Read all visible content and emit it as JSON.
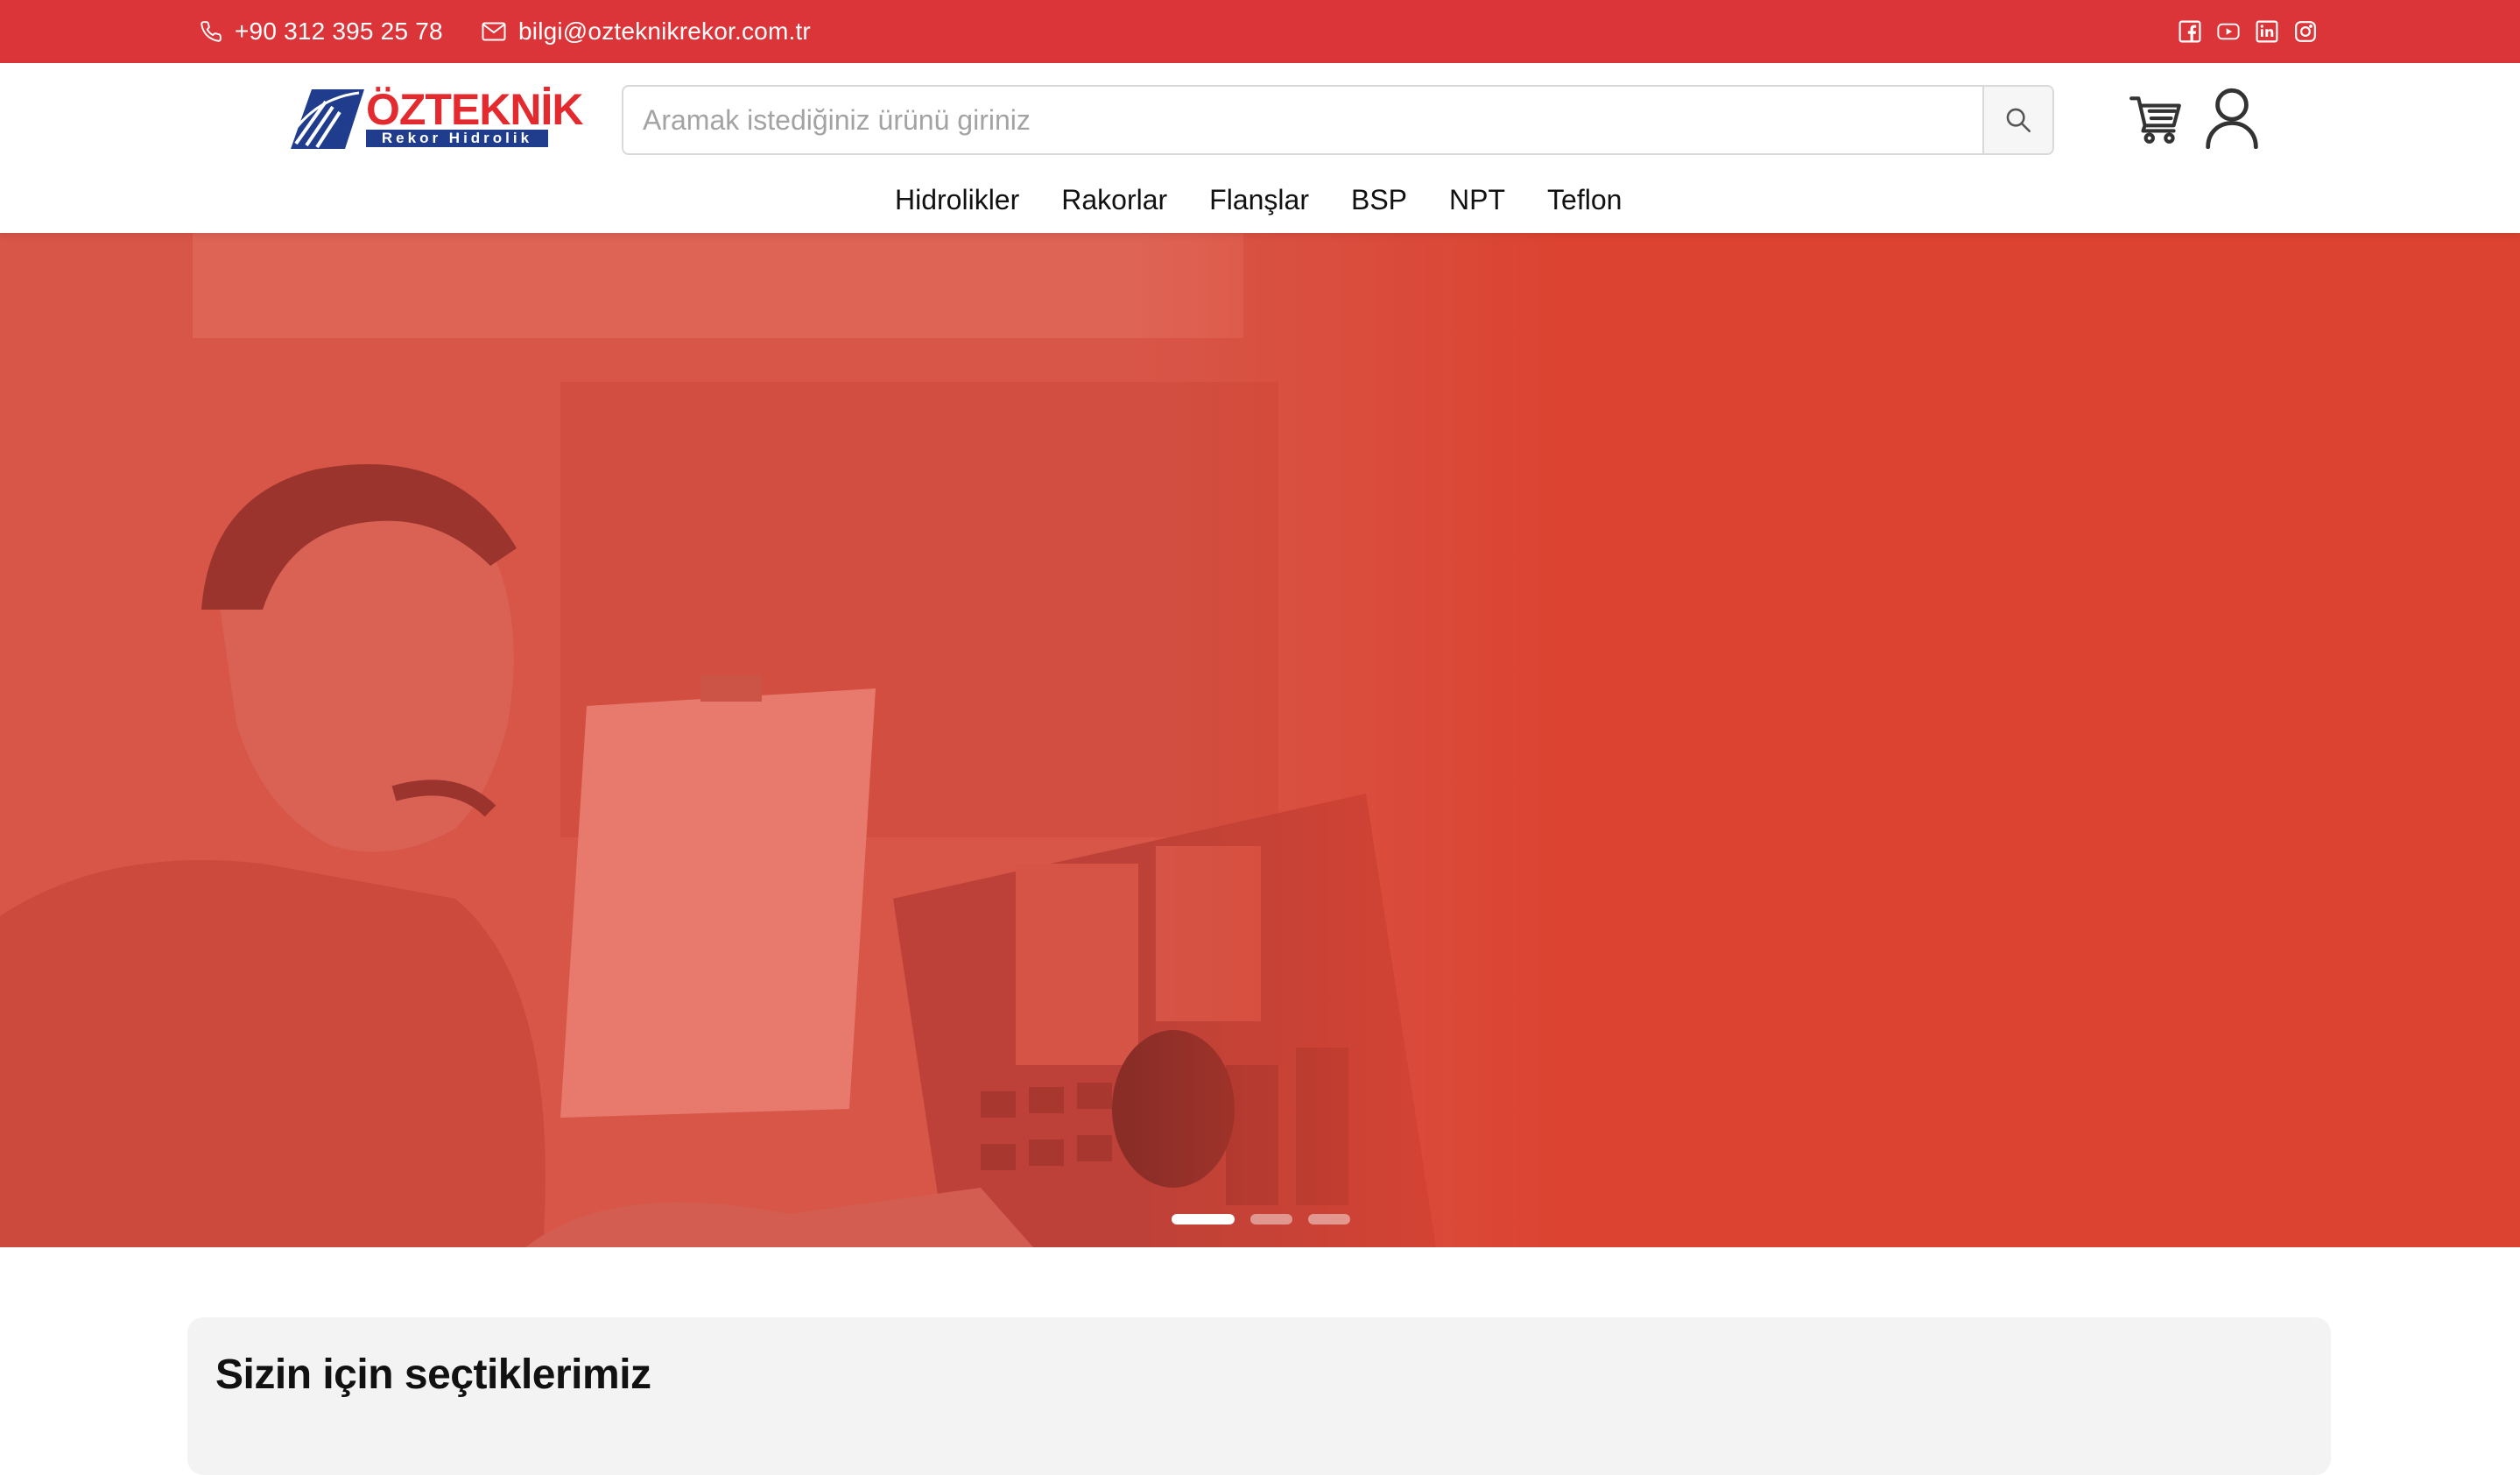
{
  "topbar": {
    "phone": "+90 312 395 25 78",
    "email": "bilgi@ozteknikrekor.com.tr",
    "socials": [
      "facebook-icon",
      "youtube-icon",
      "linkedin-icon",
      "instagram-icon"
    ],
    "background_color": "#dc3539"
  },
  "header": {
    "logo": {
      "title": "ÖZTEKNİK",
      "subtitle": "Rekor Hidrolik"
    },
    "search": {
      "placeholder": "Aramak istediğiniz ürünü giriniz",
      "value": ""
    },
    "icons": [
      "cart-icon",
      "user-icon"
    ]
  },
  "nav": {
    "items": [
      {
        "label": "Hidrolikler"
      },
      {
        "label": "Rakorlar"
      },
      {
        "label": "Flanşlar"
      },
      {
        "label": "BSP"
      },
      {
        "label": "NPT"
      },
      {
        "label": "Teflon"
      }
    ]
  },
  "hero": {
    "slides": 3,
    "active_slide": 1,
    "overlay_color": "#dc4432"
  },
  "picks": {
    "title": "Sizin için seçtiklerimiz"
  }
}
